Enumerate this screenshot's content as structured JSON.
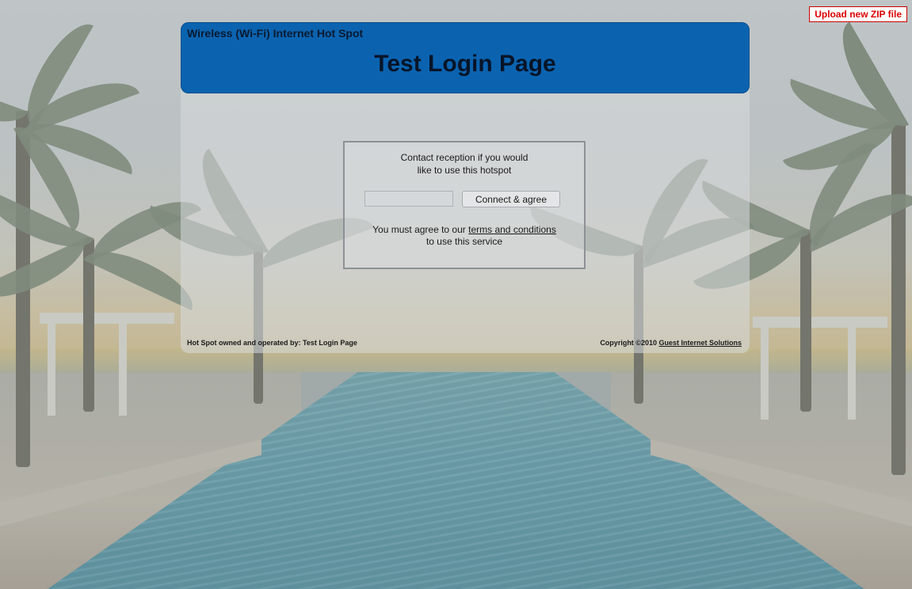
{
  "upload_link": "Upload new ZIP file",
  "header": {
    "subtitle": "Wireless (Wi-Fi) Internet Hot Spot",
    "title": "Test Login Page"
  },
  "login": {
    "line1": "Contact reception if you would",
    "line2": "like to use this hotspot",
    "input_value": "",
    "connect_button": "Connect & agree",
    "terms_prefix": "You must agree to our",
    "terms_link": "terms and conditions",
    "terms_suffix": "to use this service"
  },
  "footer": {
    "left": "Hot Spot owned and operated by: Test Login Page",
    "copyright": "Copyright ©2010",
    "company_link": "Guest Internet Solutions"
  },
  "colors": {
    "header_blue": "#0b63b0",
    "upload_red": "#dd0000"
  }
}
